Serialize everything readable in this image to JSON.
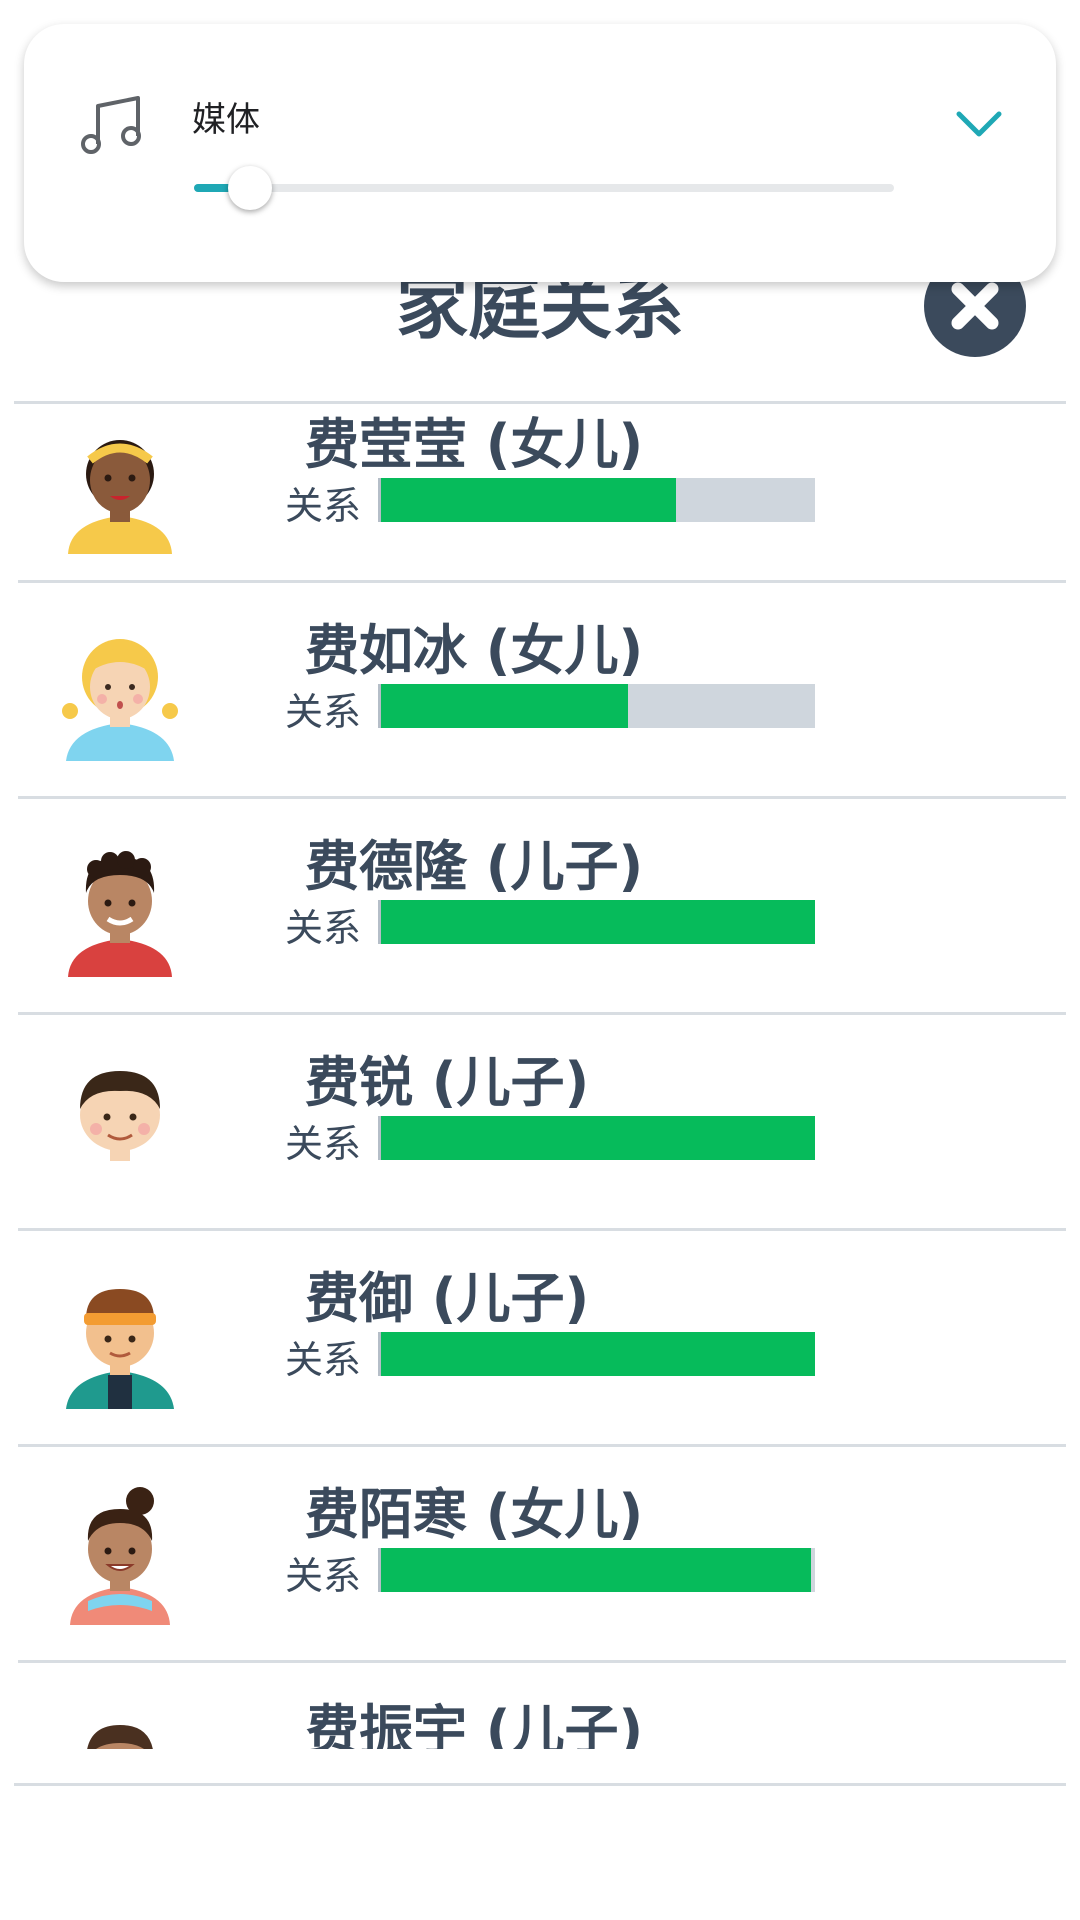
{
  "volume_panel": {
    "label": "媒体",
    "level_percent": 8,
    "accent_color": "#1fa8b5",
    "icon": "music-note-icon",
    "expand_icon": "chevron-down-icon"
  },
  "family": {
    "title": "家庭关系",
    "close_icon": "close-icon",
    "relation_label": "关系",
    "bar_fill_color": "#06bb5b",
    "bar_empty_color": "#cfd6dd",
    "members": [
      {
        "name": "费莹莹 (女儿)",
        "relation_label": "关系",
        "relationship_percent": 68,
        "avatar": "girl-headband-avatar"
      },
      {
        "name": "费如冰 (女儿)",
        "relation_label": "关系",
        "relationship_percent": 57,
        "avatar": "girl-pigtails-avatar"
      },
      {
        "name": "费德隆 (儿子)",
        "relation_label": "关系",
        "relationship_percent": 100,
        "avatar": "boy-curly-avatar"
      },
      {
        "name": "费锐 (儿子)",
        "relation_label": "关系",
        "relationship_percent": 100,
        "avatar": "boy-smiling-avatar"
      },
      {
        "name": "费御 (儿子)",
        "relation_label": "关系",
        "relationship_percent": 100,
        "avatar": "boy-headband-avatar"
      },
      {
        "name": "费陌寒 (女儿)",
        "relation_label": "关系",
        "relationship_percent": 99,
        "avatar": "girl-bun-avatar"
      },
      {
        "name": "费振宇 (儿子)",
        "relation_label": "",
        "relationship_percent": null,
        "avatar": "boy-partial-avatar"
      }
    ]
  }
}
